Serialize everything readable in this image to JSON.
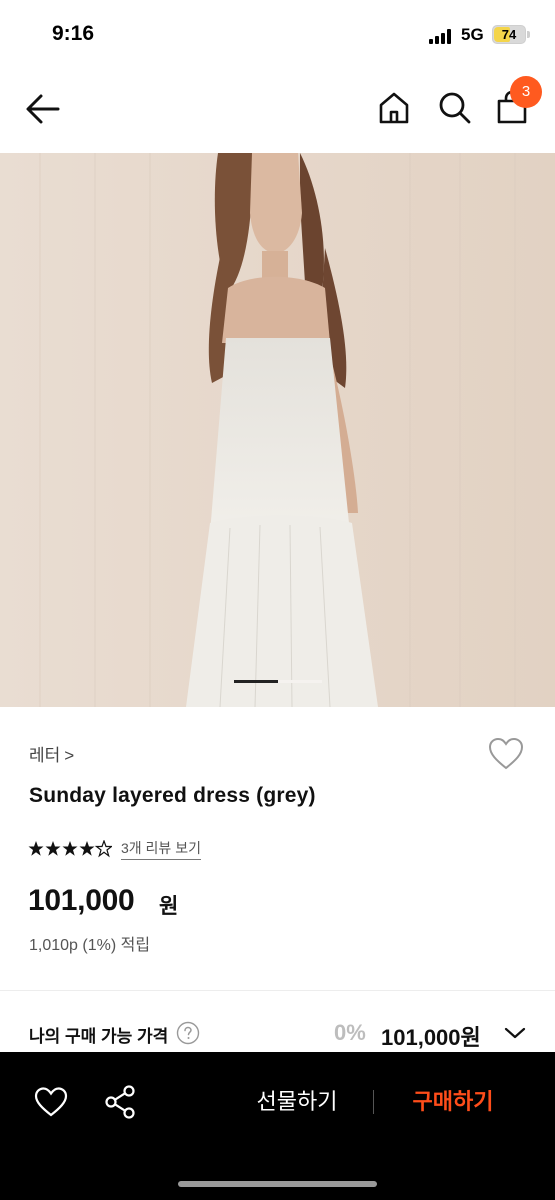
{
  "status_bar": {
    "time": "9:16",
    "network": "5G",
    "battery": "74"
  },
  "header": {
    "cart_count": "3"
  },
  "product": {
    "brand": "레터",
    "brand_chevron": ">",
    "name": "Sunday layered dress (grey)",
    "rating": 4.5,
    "review_link": "3개 리뷰 보기",
    "price": "101,000",
    "price_unit": "원",
    "points": "1,010p (1%) 적립",
    "image_index": 1,
    "image_count": 3
  },
  "my_price": {
    "label": "나의 구매 가능 가격",
    "discount": "0%",
    "price": "101,000원"
  },
  "bottom_bar": {
    "gift_label": "선물하기",
    "buy_label": "구매하기"
  },
  "colors": {
    "accent": "#ff5a1f",
    "buy": "#ff4d1a",
    "bar_bg": "#000000"
  },
  "icons": [
    "back-arrow-icon",
    "home-icon",
    "search-icon",
    "shopping-bag-icon",
    "heart-icon",
    "star-icon",
    "question-icon",
    "chevron-down-icon",
    "share-icon"
  ]
}
